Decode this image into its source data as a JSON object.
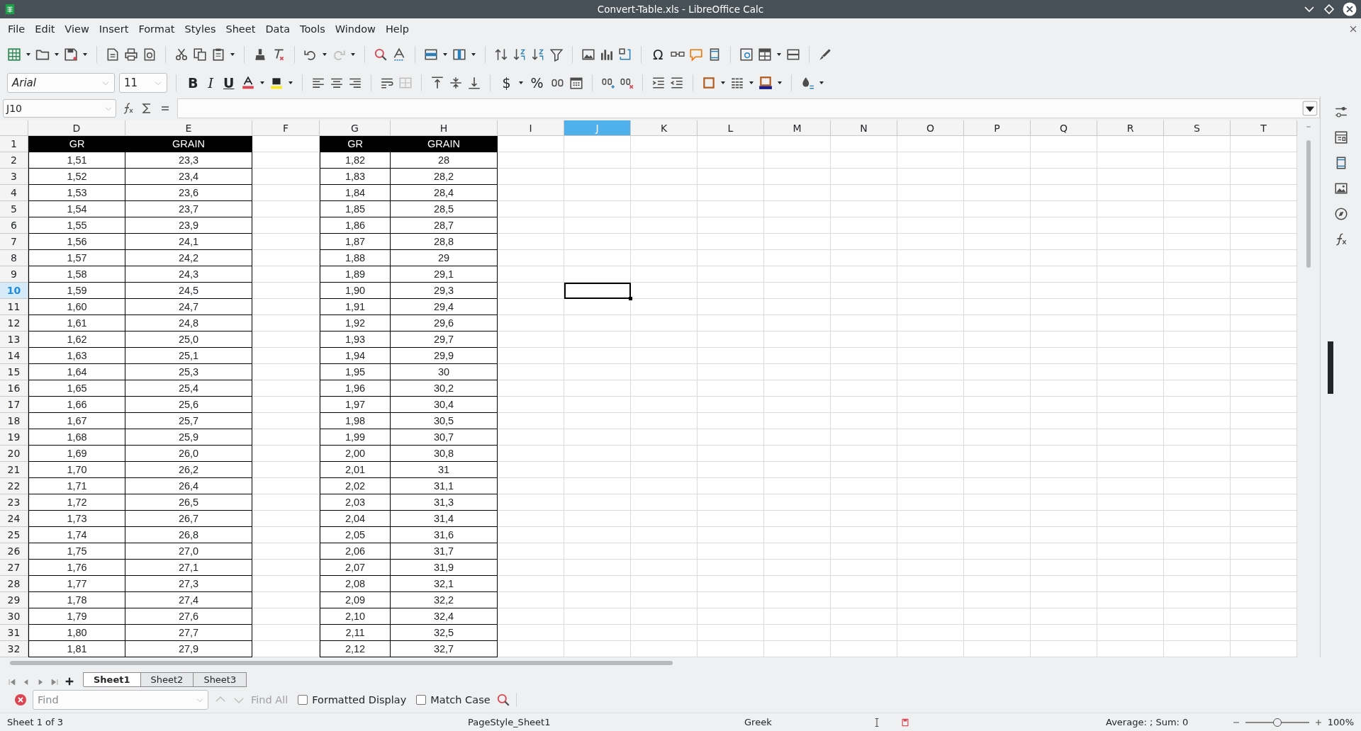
{
  "window": {
    "title": "Convert-Table.xls - LibreOffice Calc"
  },
  "menu": [
    {
      "label": "File"
    },
    {
      "label": "Edit"
    },
    {
      "label": "View"
    },
    {
      "label": "Insert"
    },
    {
      "label": "Format"
    },
    {
      "label": "Styles"
    },
    {
      "label": "Sheet"
    },
    {
      "label": "Data"
    },
    {
      "label": "Tools"
    },
    {
      "label": "Window"
    },
    {
      "label": "Help"
    }
  ],
  "toolbar": {
    "special_character": "Ω",
    "font_name": "Arial",
    "font_size": "11",
    "format_buttons": [
      {
        "kind": "bold",
        "glyph": "B"
      },
      {
        "kind": "italic",
        "glyph": "I"
      },
      {
        "kind": "underline",
        "glyph": "U"
      }
    ],
    "number_buttons": [
      {
        "glyph": "$"
      },
      {
        "glyph": "%"
      }
    ]
  },
  "formula_bar": {
    "name_box": "J10"
  },
  "columns": [
    {
      "label": "D",
      "selected": false
    },
    {
      "label": "E",
      "selected": false
    },
    {
      "label": "F",
      "selected": false
    },
    {
      "label": "G",
      "selected": false
    },
    {
      "label": "H",
      "selected": false
    },
    {
      "label": "I",
      "selected": false
    },
    {
      "label": "J",
      "selected": true
    },
    {
      "label": "K",
      "selected": false
    },
    {
      "label": "L",
      "selected": false
    },
    {
      "label": "M",
      "selected": false
    },
    {
      "label": "N",
      "selected": false
    },
    {
      "label": "O",
      "selected": false
    },
    {
      "label": "P",
      "selected": false
    },
    {
      "label": "Q",
      "selected": false
    },
    {
      "label": "R",
      "selected": false
    },
    {
      "label": "S",
      "selected": false
    },
    {
      "label": "T",
      "selected": false
    }
  ],
  "rows": [
    {
      "number": "1",
      "selected": false,
      "kind": "header",
      "d": "GR",
      "e": "GRAIN",
      "g": "GR",
      "h": "GRAIN"
    },
    {
      "number": "2",
      "selected": false,
      "kind": "data",
      "d": "1,51",
      "e": "23,3",
      "g": "1,82",
      "h": "28"
    },
    {
      "number": "3",
      "selected": false,
      "kind": "data",
      "d": "1,52",
      "e": "23,4",
      "g": "1,83",
      "h": "28,2"
    },
    {
      "number": "4",
      "selected": false,
      "kind": "data",
      "d": "1,53",
      "e": "23,6",
      "g": "1,84",
      "h": "28,4"
    },
    {
      "number": "5",
      "selected": false,
      "kind": "data",
      "d": "1,54",
      "e": "23,7",
      "g": "1,85",
      "h": "28,5"
    },
    {
      "number": "6",
      "selected": false,
      "kind": "data",
      "d": "1,55",
      "e": "23,9",
      "g": "1,86",
      "h": "28,7"
    },
    {
      "number": "7",
      "selected": false,
      "kind": "data",
      "d": "1,56",
      "e": "24,1",
      "g": "1,87",
      "h": "28,8"
    },
    {
      "number": "8",
      "selected": false,
      "kind": "data",
      "d": "1,57",
      "e": "24,2",
      "g": "1,88",
      "h": "29"
    },
    {
      "number": "9",
      "selected": false,
      "kind": "data",
      "d": "1,58",
      "e": "24,3",
      "g": "1,89",
      "h": "29,1"
    },
    {
      "number": "10",
      "selected": true,
      "kind": "data",
      "d": "1,59",
      "e": "24,5",
      "g": "1,90",
      "h": "29,3"
    },
    {
      "number": "11",
      "selected": false,
      "kind": "data",
      "d": "1,60",
      "e": "24,7",
      "g": "1,91",
      "h": "29,4"
    },
    {
      "number": "12",
      "selected": false,
      "kind": "data",
      "d": "1,61",
      "e": "24,8",
      "g": "1,92",
      "h": "29,6"
    },
    {
      "number": "13",
      "selected": false,
      "kind": "data",
      "d": "1,62",
      "e": "25,0",
      "g": "1,93",
      "h": "29,7"
    },
    {
      "number": "14",
      "selected": false,
      "kind": "data",
      "d": "1,63",
      "e": "25,1",
      "g": "1,94",
      "h": "29,9"
    },
    {
      "number": "15",
      "selected": false,
      "kind": "data",
      "d": "1,64",
      "e": "25,3",
      "g": "1,95",
      "h": "30"
    },
    {
      "number": "16",
      "selected": false,
      "kind": "data",
      "d": "1,65",
      "e": "25,4",
      "g": "1,96",
      "h": "30,2"
    },
    {
      "number": "17",
      "selected": false,
      "kind": "data",
      "d": "1,66",
      "e": "25,6",
      "g": "1,97",
      "h": "30,4"
    },
    {
      "number": "18",
      "selected": false,
      "kind": "data",
      "d": "1,67",
      "e": "25,7",
      "g": "1,98",
      "h": "30,5"
    },
    {
      "number": "19",
      "selected": false,
      "kind": "data",
      "d": "1,68",
      "e": "25,9",
      "g": "1,99",
      "h": "30,7"
    },
    {
      "number": "20",
      "selected": false,
      "kind": "data",
      "d": "1,69",
      "e": "26,0",
      "g": "2,00",
      "h": "30,8"
    },
    {
      "number": "21",
      "selected": false,
      "kind": "data",
      "d": "1,70",
      "e": "26,2",
      "g": "2,01",
      "h": "31"
    },
    {
      "number": "22",
      "selected": false,
      "kind": "data",
      "d": "1,71",
      "e": "26,4",
      "g": "2,02",
      "h": "31,1"
    },
    {
      "number": "23",
      "selected": false,
      "kind": "data",
      "d": "1,72",
      "e": "26,5",
      "g": "2,03",
      "h": "31,3"
    },
    {
      "number": "24",
      "selected": false,
      "kind": "data",
      "d": "1,73",
      "e": "26,7",
      "g": "2,04",
      "h": "31,4"
    },
    {
      "number": "25",
      "selected": false,
      "kind": "data",
      "d": "1,74",
      "e": "26,8",
      "g": "2,05",
      "h": "31,6"
    },
    {
      "number": "26",
      "selected": false,
      "kind": "data",
      "d": "1,75",
      "e": "27,0",
      "g": "2,06",
      "h": "31,7"
    },
    {
      "number": "27",
      "selected": false,
      "kind": "data",
      "d": "1,76",
      "e": "27,1",
      "g": "2,07",
      "h": "31,9"
    },
    {
      "number": "28",
      "selected": false,
      "kind": "data",
      "d": "1,77",
      "e": "27,3",
      "g": "2,08",
      "h": "32,1"
    },
    {
      "number": "29",
      "selected": false,
      "kind": "data",
      "d": "1,78",
      "e": "27,4",
      "g": "2,09",
      "h": "32,2"
    },
    {
      "number": "30",
      "selected": false,
      "kind": "data",
      "d": "1,79",
      "e": "27,6",
      "g": "2,10",
      "h": "32,4"
    },
    {
      "number": "31",
      "selected": false,
      "kind": "data",
      "d": "1,80",
      "e": "27,7",
      "g": "2,11",
      "h": "32,5"
    },
    {
      "number": "32",
      "selected": false,
      "kind": "data",
      "d": "1,81",
      "e": "27,9",
      "g": "2,12",
      "h": "32,7"
    }
  ],
  "sheet_tabs": [
    {
      "label": "Sheet1",
      "selected": true
    },
    {
      "label": "Sheet2",
      "selected": false
    },
    {
      "label": "Sheet3",
      "selected": false
    }
  ],
  "find_bar": {
    "placeholder": "Find",
    "find_all": {
      "label": "Find All",
      "disabled": true
    },
    "options": [
      {
        "label": "Formatted Display",
        "checked": false
      },
      {
        "label": "Match Case",
        "checked": false
      }
    ]
  },
  "status_bar": {
    "sheet": "Sheet 1 of 3",
    "page_style": "PageStyle_Sheet1",
    "language": "Greek",
    "summary": "Average: ; Sum: 0",
    "zoom_slider": {
      "level": 0.5
    },
    "zoom": "100%"
  }
}
